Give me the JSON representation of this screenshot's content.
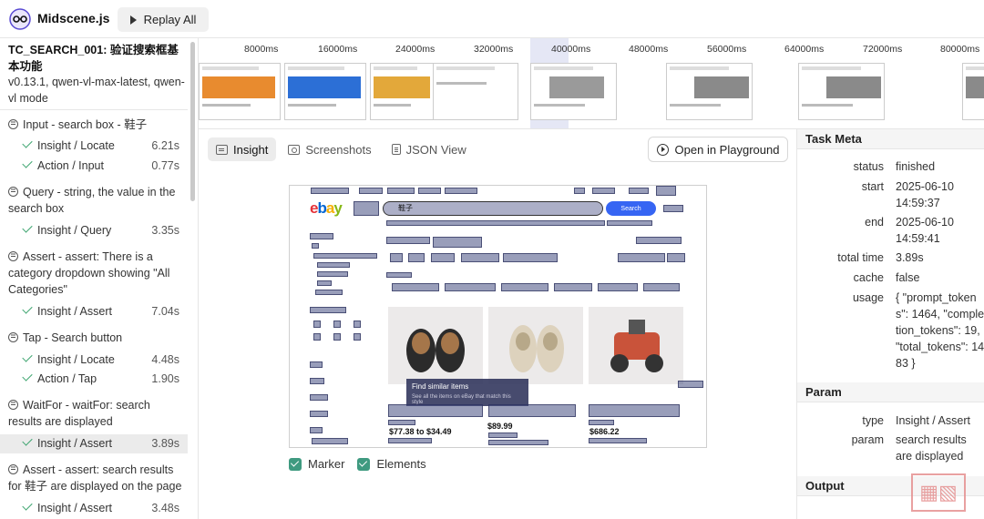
{
  "app": {
    "name": "Midscene.js",
    "replay_label": "Replay All"
  },
  "sidebar": {
    "case_title": "TC_SEARCH_001: 验证搜索框基本功能",
    "case_subtitle": "v0.13.1, qwen-vl-max-latest, qwen-vl mode",
    "tasks": [
      {
        "title": "Input - search box - 鞋子",
        "subs": [
          {
            "label": "Insight / Locate",
            "duration": "6.21s"
          },
          {
            "label": "Action / Input",
            "duration": "0.77s"
          }
        ]
      },
      {
        "title": "Query - string, the value in the search box",
        "subs": [
          {
            "label": "Insight / Query",
            "duration": "3.35s"
          }
        ]
      },
      {
        "title": "Assert - assert: There is a category dropdown showing \"All Categories\"",
        "subs": [
          {
            "label": "Insight / Assert",
            "duration": "7.04s"
          }
        ]
      },
      {
        "title": "Tap - Search button",
        "subs": [
          {
            "label": "Insight / Locate",
            "duration": "4.48s"
          },
          {
            "label": "Action / Tap",
            "duration": "1.90s"
          }
        ]
      },
      {
        "title": "WaitFor - waitFor: search results are displayed",
        "subs": [
          {
            "label": "Insight / Assert",
            "duration": "3.89s",
            "active": true
          }
        ]
      },
      {
        "title": "Assert - assert: search results for 鞋子 are displayed on the page",
        "subs": [
          {
            "label": "Insight / Assert",
            "duration": "3.48s"
          }
        ]
      }
    ]
  },
  "timeline": {
    "ticks": [
      "8000ms",
      "16000ms",
      "24000ms",
      "32000ms",
      "40000ms",
      "48000ms",
      "56000ms",
      "64000ms",
      "72000ms",
      "80000ms"
    ]
  },
  "main": {
    "tabs": [
      {
        "label": "Insight",
        "icon": "insight-icon",
        "active": true
      },
      {
        "label": "Screenshots",
        "icon": "camera-icon"
      },
      {
        "label": "JSON View",
        "icon": "document-icon"
      }
    ],
    "playground_label": "Open in Playground",
    "checkboxes": [
      {
        "label": "Marker",
        "checked": true
      },
      {
        "label": "Elements",
        "checked": true
      }
    ],
    "screenshot": {
      "search_text": "鞋子",
      "search_button": "Search",
      "popup_title": "Find similar items",
      "popup_text": "See all the items on eBay that match this style",
      "prices": [
        "$77.38 to $34.49",
        "$89.99",
        "$686.22"
      ]
    }
  },
  "task_meta": {
    "heading": "Task Meta",
    "rows": [
      {
        "key": "status",
        "value": "finished"
      },
      {
        "key": "start",
        "value": "2025-06-10 14:59:37"
      },
      {
        "key": "end",
        "value": "2025-06-10 14:59:41"
      },
      {
        "key": "total time",
        "value": "3.89s"
      },
      {
        "key": "cache",
        "value": "false"
      },
      {
        "key": "usage",
        "value": "{ \"prompt_tokens\": 1464, \"completion_tokens\": 19, \"total_tokens\": 1483 }"
      }
    ]
  },
  "param": {
    "heading": "Param",
    "rows": [
      {
        "key": "type",
        "value": "Insight / Assert"
      },
      {
        "key": "param",
        "value": "search results are displayed"
      }
    ]
  },
  "output": {
    "heading": "Output"
  }
}
